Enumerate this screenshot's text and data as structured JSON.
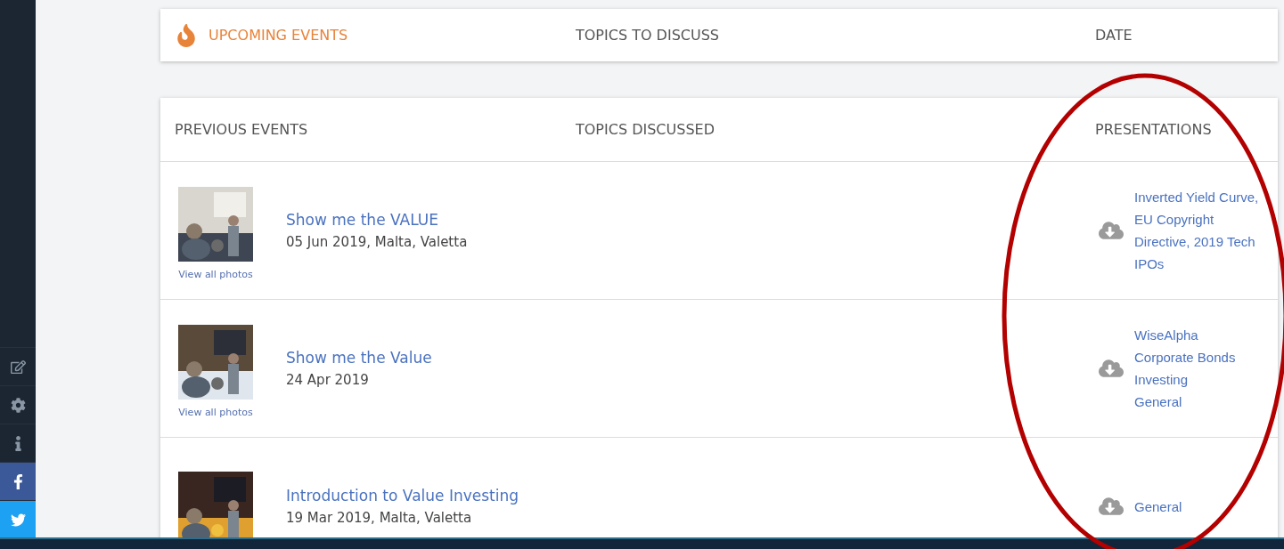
{
  "sidebar": {
    "icons": [
      {
        "kind": "edit"
      },
      {
        "kind": "settings"
      },
      {
        "kind": "info"
      },
      {
        "kind": "facebook"
      },
      {
        "kind": "twitter"
      }
    ]
  },
  "upcoming": {
    "columns": [
      "UPCOMING EVENTS",
      "TOPICS TO DISCUSS",
      "DATE"
    ]
  },
  "previous": {
    "columns": [
      "PREVIOUS EVENTS",
      "TOPICS DISCUSSED",
      "PRESENTATIONS"
    ],
    "rows": [
      {
        "title": "Show me the VALUE",
        "date": "05 Jun 2019, Malta, Valetta",
        "photos_link": "View all photos",
        "presentations": [
          "Inverted Yield Curve, EU Copyright Directive, 2019 Tech IPOs"
        ]
      },
      {
        "title": "Show me the Value",
        "date": "24 Apr 2019",
        "photos_link": "View all photos",
        "presentations": [
          "WiseAlpha",
          "Corporate Bonds",
          "Investing",
          "General"
        ]
      },
      {
        "title": "Introduction to Value Investing",
        "date": "19 Mar 2019, Malta, Valetta",
        "presentations": [
          "General"
        ]
      }
    ]
  }
}
